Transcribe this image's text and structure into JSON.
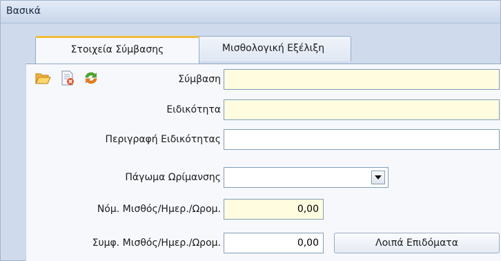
{
  "group": {
    "title": "Βασικά"
  },
  "tabs": [
    {
      "label": "Στοιχεία Σύμβασης",
      "selected": true
    },
    {
      "label": "Μισθολογική Εξέλιξη",
      "selected": false
    }
  ],
  "toolbar_icons": [
    "open-folder-icon",
    "delete-document-icon",
    "refresh-icon"
  ],
  "form": {
    "contract": {
      "label": "Σύμβαση",
      "value": ""
    },
    "specialty": {
      "label": "Ειδικότητα",
      "value": ""
    },
    "specialty_description": {
      "label": "Περιγραφή Ειδικότητας",
      "value": ""
    },
    "maturity_freeze": {
      "label": "Πάγωμα Ωρίμανσης",
      "value": ""
    },
    "legal_salary": {
      "label": "Νόμ. Μισθός/Ημερ./Ωρομ.",
      "value": "0,00"
    },
    "contract_salary": {
      "label": "Συμφ. Μισθός/Ημερ./Ωρομ.",
      "value": "0,00"
    }
  },
  "buttons": {
    "other_allowances": "Λοιπά Επιδόματα"
  },
  "colors": {
    "accent_tab": "#f0bd3a",
    "required_field": "#fffce0",
    "panel": "#f6f8fc",
    "frame": "#cfdbec"
  }
}
